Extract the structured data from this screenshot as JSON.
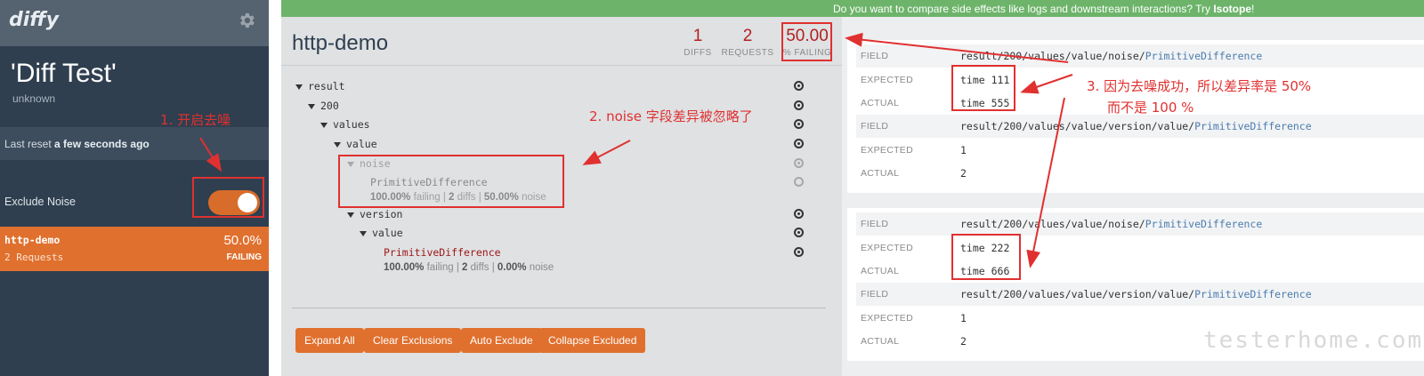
{
  "sidebar": {
    "logo": "diffy",
    "title": "'Diff Test'",
    "subtitle": "unknown",
    "reset_prefix": "Last reset ",
    "reset_time": "a few seconds ago",
    "exclude_label": "Exclude Noise",
    "endpoint": {
      "name": "http-demo",
      "requests": "2 Requests",
      "percent": "50.0%",
      "status": "FAILING"
    }
  },
  "banner": {
    "text": "Do you want to compare side effects like logs and downstream interactions? Try ",
    "link": "Isotope",
    "suffix": "!"
  },
  "main": {
    "title": "http-demo",
    "stats": [
      {
        "num": "1",
        "cap": "DIFFS"
      },
      {
        "num": "2",
        "cap": "REQUESTS"
      },
      {
        "num": "50.00",
        "cap": "% FAILING"
      }
    ],
    "tree": {
      "result": "result",
      "k200": "200",
      "values": "values",
      "value": "value",
      "noise": "noise",
      "noise_type": "PrimitiveDifference",
      "noise_meta": {
        "a": "100.00%",
        "b": " failing | ",
        "c": "2",
        "d": " diffs | ",
        "e": "50.00%",
        "f": " noise"
      },
      "version": "version",
      "value2": "value",
      "version_type": "PrimitiveDifference",
      "version_meta": {
        "a": "100.00%",
        "b": " failing | ",
        "c": "2",
        "d": " diffs | ",
        "e": "0.00%",
        "f": " noise"
      }
    },
    "buttons": [
      "Expand All",
      "Clear Exclusions",
      "Auto Exclude",
      "Collapse Excluded"
    ]
  },
  "cards": [
    {
      "rows": [
        {
          "k": "FIELD",
          "path": "result/200/values/value/noise/",
          "cls": "PrimitiveDifference"
        },
        {
          "k": "EXPECTED",
          "path": "time 111",
          "cls": ""
        },
        {
          "k": "ACTUAL",
          "path": "time 555",
          "cls": ""
        },
        {
          "k": "FIELD",
          "path": "result/200/values/value/version/value/",
          "cls": "PrimitiveDifference"
        },
        {
          "k": "EXPECTED",
          "path": "1",
          "cls": ""
        },
        {
          "k": "ACTUAL",
          "path": "2",
          "cls": ""
        }
      ]
    },
    {
      "rows": [
        {
          "k": "FIELD",
          "path": "result/200/values/value/noise/",
          "cls": "PrimitiveDifference"
        },
        {
          "k": "EXPECTED",
          "path": "time 222",
          "cls": ""
        },
        {
          "k": "ACTUAL",
          "path": "time 666",
          "cls": ""
        },
        {
          "k": "FIELD",
          "path": "result/200/values/value/version/value/",
          "cls": "PrimitiveDifference"
        },
        {
          "k": "EXPECTED",
          "path": "1",
          "cls": ""
        },
        {
          "k": "ACTUAL",
          "path": "2",
          "cls": ""
        }
      ]
    }
  ],
  "annotations": {
    "a1": "1. 开启去噪",
    "a2": "2. noise 字段差异被忽略了",
    "a3_line1": "3. 因为去噪成功，所以差异率是 50%",
    "a3_line2": "而不是 100 %"
  },
  "watermark": "testerhome.com",
  "colors": {
    "accent": "#e0702e",
    "sidebar": "#2f3f4f",
    "banner": "#6db46a",
    "annotation": "#e03030",
    "failing": "#b22020"
  }
}
